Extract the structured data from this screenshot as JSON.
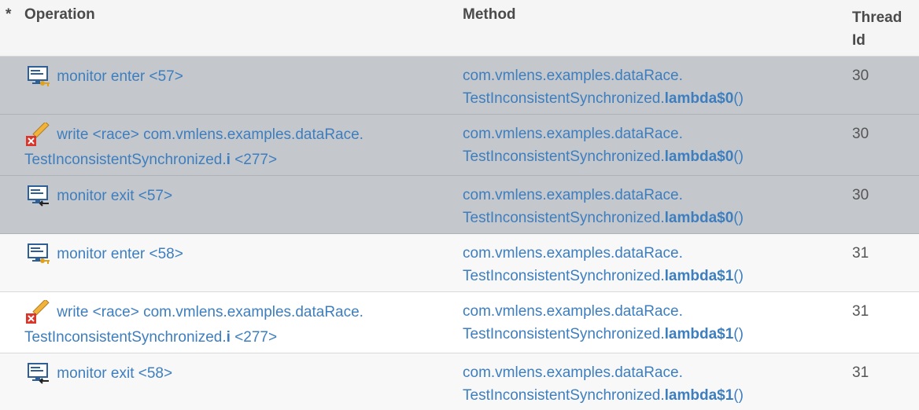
{
  "header": {
    "star": "*",
    "operation": "Operation",
    "method": "Method",
    "thread_id": "Thread Id"
  },
  "rows": [
    {
      "icon": "monitor-enter-icon",
      "op_prefix": "monitor enter <57>",
      "op_field": "",
      "op_suffix": "",
      "method_line1": "com.vmlens.examples.dataRace.",
      "method_class": "TestInconsistentSynchronized.",
      "method_name": "lambda$0",
      "method_parens": "()",
      "thread": "30"
    },
    {
      "icon": "write-race-icon",
      "op_prefix": "write <race> com.vmlens.examples.dataRace.",
      "op_line2": "TestInconsistentSynchronized.",
      "op_field": "i",
      "op_suffix": " <277>",
      "method_line1": "com.vmlens.examples.dataRace.",
      "method_class": "TestInconsistentSynchronized.",
      "method_name": "lambda$0",
      "method_parens": "()",
      "thread": "30"
    },
    {
      "icon": "monitor-exit-icon",
      "op_prefix": "monitor exit <57>",
      "op_field": "",
      "op_suffix": "",
      "method_line1": "com.vmlens.examples.dataRace.",
      "method_class": "TestInconsistentSynchronized.",
      "method_name": "lambda$0",
      "method_parens": "()",
      "thread": "30"
    },
    {
      "icon": "monitor-enter-icon",
      "op_prefix": "monitor enter <58>",
      "op_field": "",
      "op_suffix": "",
      "method_line1": "com.vmlens.examples.dataRace.",
      "method_class": "TestInconsistentSynchronized.",
      "method_name": "lambda$1",
      "method_parens": "()",
      "thread": "31"
    },
    {
      "icon": "write-race-icon",
      "op_prefix": "write <race> com.vmlens.examples.dataRace.",
      "op_line2": "TestInconsistentSynchronized.",
      "op_field": "i",
      "op_suffix": " <277>",
      "method_line1": "com.vmlens.examples.dataRace.",
      "method_class": "TestInconsistentSynchronized.",
      "method_name": "lambda$1",
      "method_parens": "()",
      "thread": "31"
    },
    {
      "icon": "monitor-exit-icon",
      "op_prefix": "monitor exit <58>",
      "op_field": "",
      "op_suffix": "",
      "method_line1": "com.vmlens.examples.dataRace.",
      "method_class": "TestInconsistentSynchronized.",
      "method_name": "lambda$1",
      "method_parens": "()",
      "thread": "31"
    }
  ],
  "colors": {
    "link": "#3d7ebf",
    "selected_row": "#c4c7cc",
    "header_bg": "#f5f5f5",
    "race_red": "#d9362c"
  }
}
